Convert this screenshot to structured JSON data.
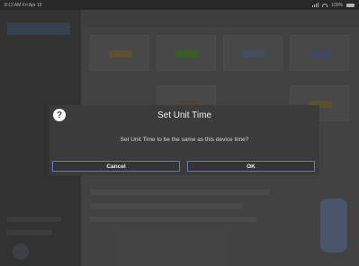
{
  "status_bar": {
    "time": "8:13 AM",
    "date": "Fri Apr 19",
    "battery": "100%"
  },
  "background": {
    "tile_colors": [
      "#6a5a3c",
      "#3f6b2c",
      "#4d5a6e",
      "#4a5270",
      "#5a4f3f",
      "#6b5a35"
    ]
  },
  "dialog": {
    "title": "Set Unit Time",
    "message": "Set Unit Time to be the same as this device time?",
    "cancel_label": "Cancel",
    "ok_label": "OK",
    "help_symbol": "?"
  }
}
